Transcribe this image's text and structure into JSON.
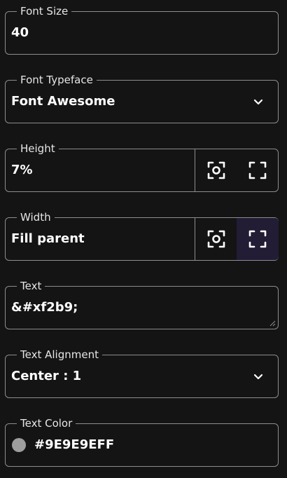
{
  "font_size": {
    "legend": "Font Size",
    "value": "40"
  },
  "font_typeface": {
    "legend": "Font Typeface",
    "value": "Font Awesome",
    "chevron_icon": "chevron-down-icon"
  },
  "height": {
    "legend": "Height",
    "value": "7%",
    "fit_icon": "fit-content-icon",
    "fill_icon": "fill-parent-icon",
    "active": "none"
  },
  "width": {
    "legend": "Width",
    "value": "Fill parent",
    "fit_icon": "fit-content-icon",
    "fill_icon": "fill-parent-icon",
    "active": "fill"
  },
  "text": {
    "legend": "Text",
    "value": "&#xf2b9;"
  },
  "text_alignment": {
    "legend": "Text Alignment",
    "value": "Center : 1",
    "chevron_icon": "chevron-down-icon"
  },
  "text_color": {
    "legend": "Text Color",
    "value": "#9E9E9EFF",
    "swatch_color": "#9e9e9e"
  },
  "colors": {
    "background": "#141414",
    "border": "#8d8d8d",
    "active_button": "#221c35"
  }
}
